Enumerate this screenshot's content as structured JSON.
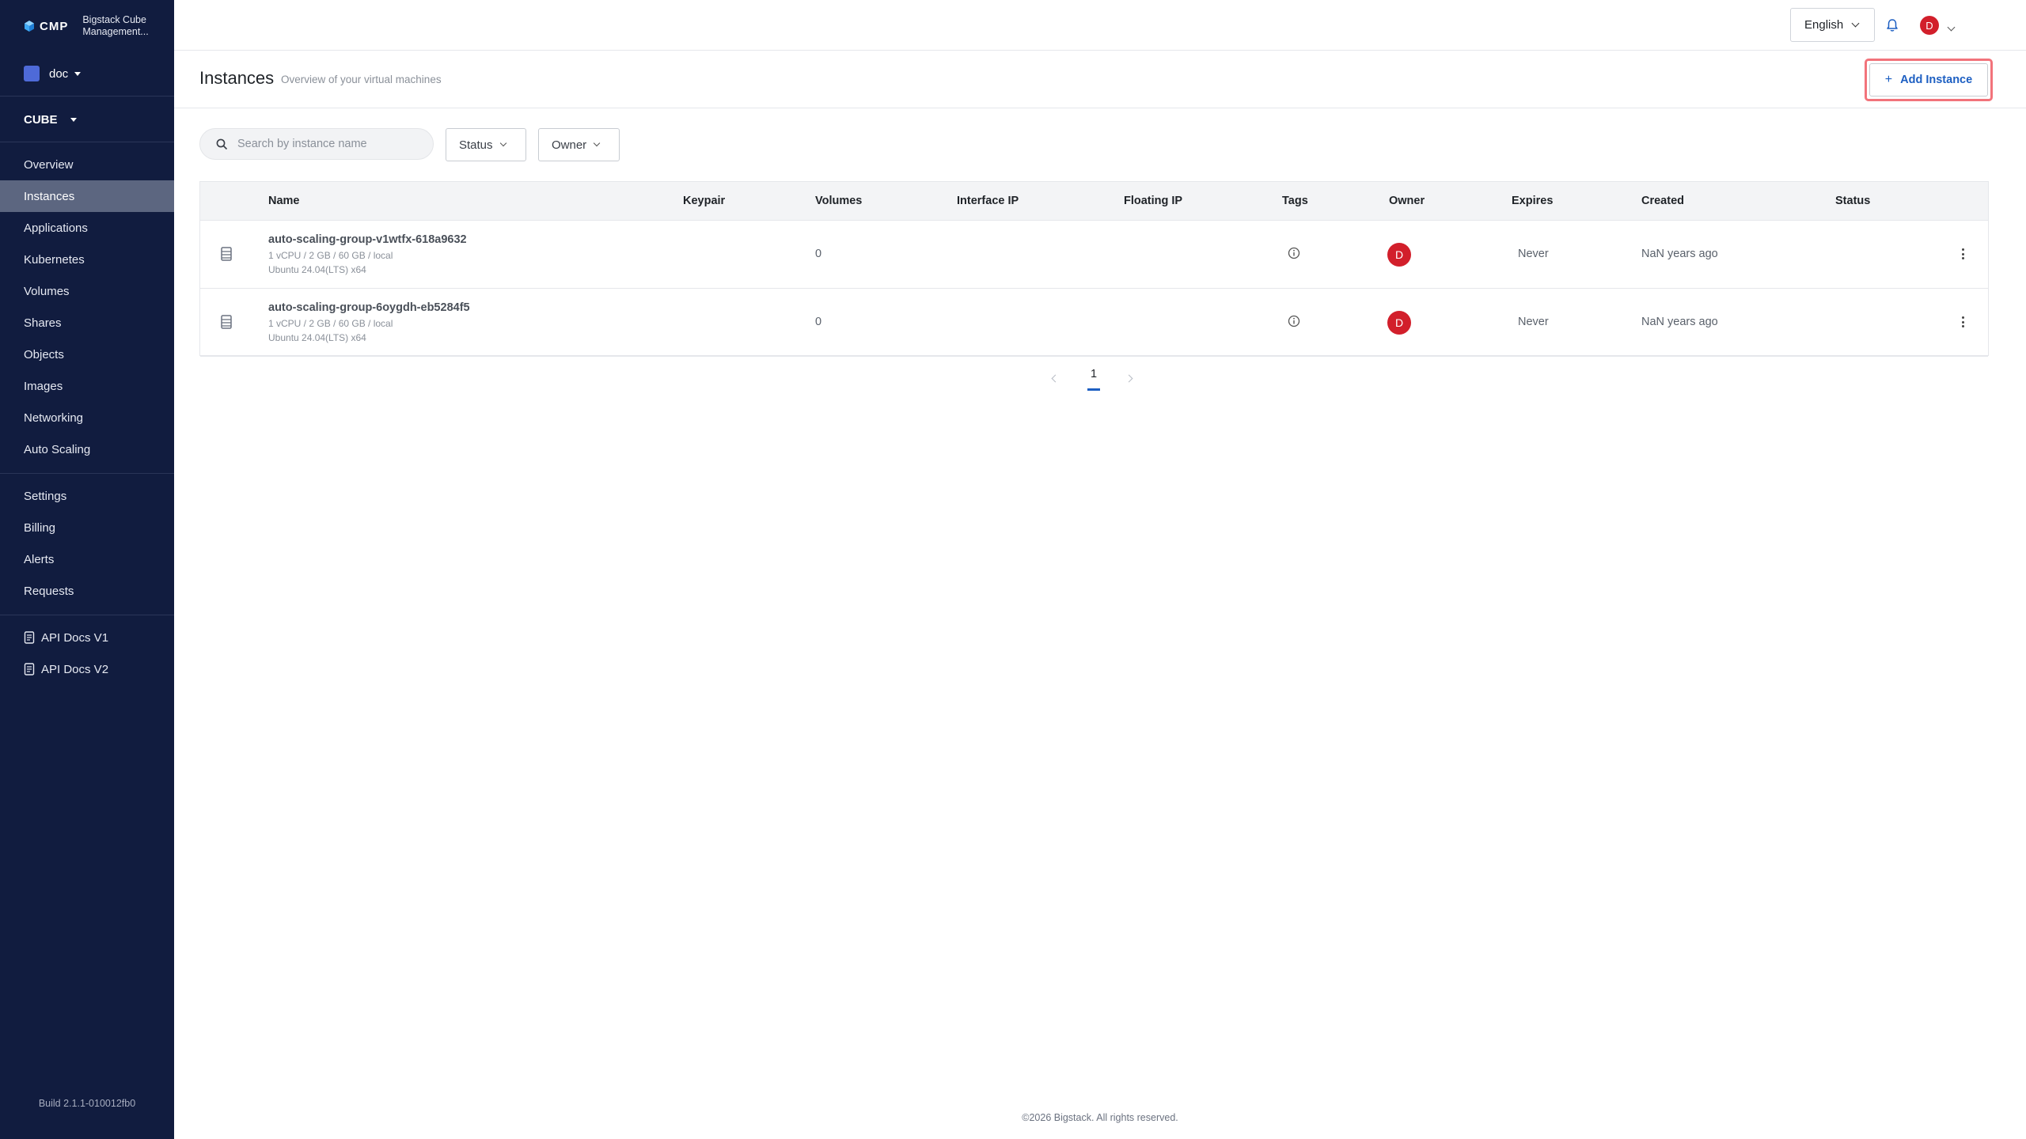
{
  "sidebar": {
    "brand_short": "CMP",
    "brand_name": "Bigstack Cube Management...",
    "org": "doc",
    "project": "CUBE",
    "nav": [
      "Overview",
      "Instances",
      "Applications",
      "Kubernetes",
      "Volumes",
      "Shares",
      "Objects",
      "Images",
      "Networking",
      "Auto Scaling"
    ],
    "nav2": [
      "Settings",
      "Billing",
      "Alerts",
      "Requests"
    ],
    "docs": [
      "API Docs V1",
      "API Docs V2"
    ],
    "active": "Instances",
    "build": "Build 2.1.1-010012fb0"
  },
  "topbar": {
    "language": "English",
    "user_initial": "D"
  },
  "page": {
    "title": "Instances",
    "subtitle": "Overview of your virtual machines",
    "add_button": "Add Instance"
  },
  "filters": {
    "search_placeholder": "Search by instance name",
    "status": "Status",
    "owner": "Owner"
  },
  "table": {
    "columns": [
      "Name",
      "Keypair",
      "Volumes",
      "Interface IP",
      "Floating IP",
      "Tags",
      "Owner",
      "Expires",
      "Created",
      "Status"
    ],
    "rows": [
      {
        "name": "auto-scaling-group-v1wtfx-618a9632",
        "spec": "1 vCPU / 2 GB / 60 GB / local",
        "os": "Ubuntu 24.04(LTS) x64",
        "keypair": "",
        "volumes": "0",
        "interface_ip": "",
        "floating_ip": "",
        "owner_initial": "D",
        "expires": "Never",
        "created": "NaN years ago",
        "status": ""
      },
      {
        "name": "auto-scaling-group-6oygdh-eb5284f5",
        "spec": "1 vCPU / 2 GB / 60 GB / local",
        "os": "Ubuntu 24.04(LTS) x64",
        "keypair": "",
        "volumes": "0",
        "interface_ip": "",
        "floating_ip": "",
        "owner_initial": "D",
        "expires": "Never",
        "created": "NaN years ago",
        "status": ""
      }
    ]
  },
  "pagination": {
    "current_page": "1"
  },
  "footer": "©2026 Bigstack. All rights reserved.",
  "colors": {
    "sidebar_bg": "#111c3f",
    "active_item": "#5c6680",
    "accent": "#1d5fc2",
    "avatar": "#d21f2b",
    "highlight": "#f2737b"
  }
}
